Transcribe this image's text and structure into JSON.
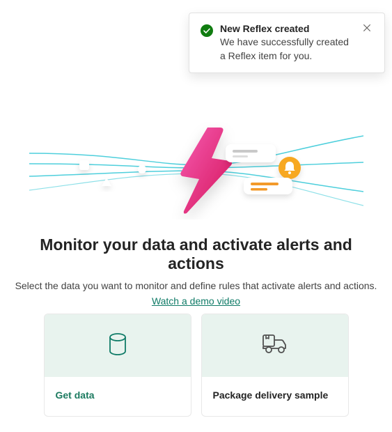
{
  "toast": {
    "title": "New Reflex created",
    "message": "We have successfully created a Reflex item for you."
  },
  "heading": "Monitor your data and activate alerts and actions",
  "subtitle": "Select the data you want to monitor and define rules that activate alerts and actions.",
  "demo_link": "Watch a demo video",
  "cards": {
    "get_data": {
      "label": "Get data"
    },
    "sample": {
      "label": "Package delivery sample"
    }
  },
  "colors": {
    "accent": "#0f7b67",
    "bolt_top": "#f24aa0",
    "bolt_bottom": "#d4145a",
    "bell_bg": "#f7a823"
  }
}
